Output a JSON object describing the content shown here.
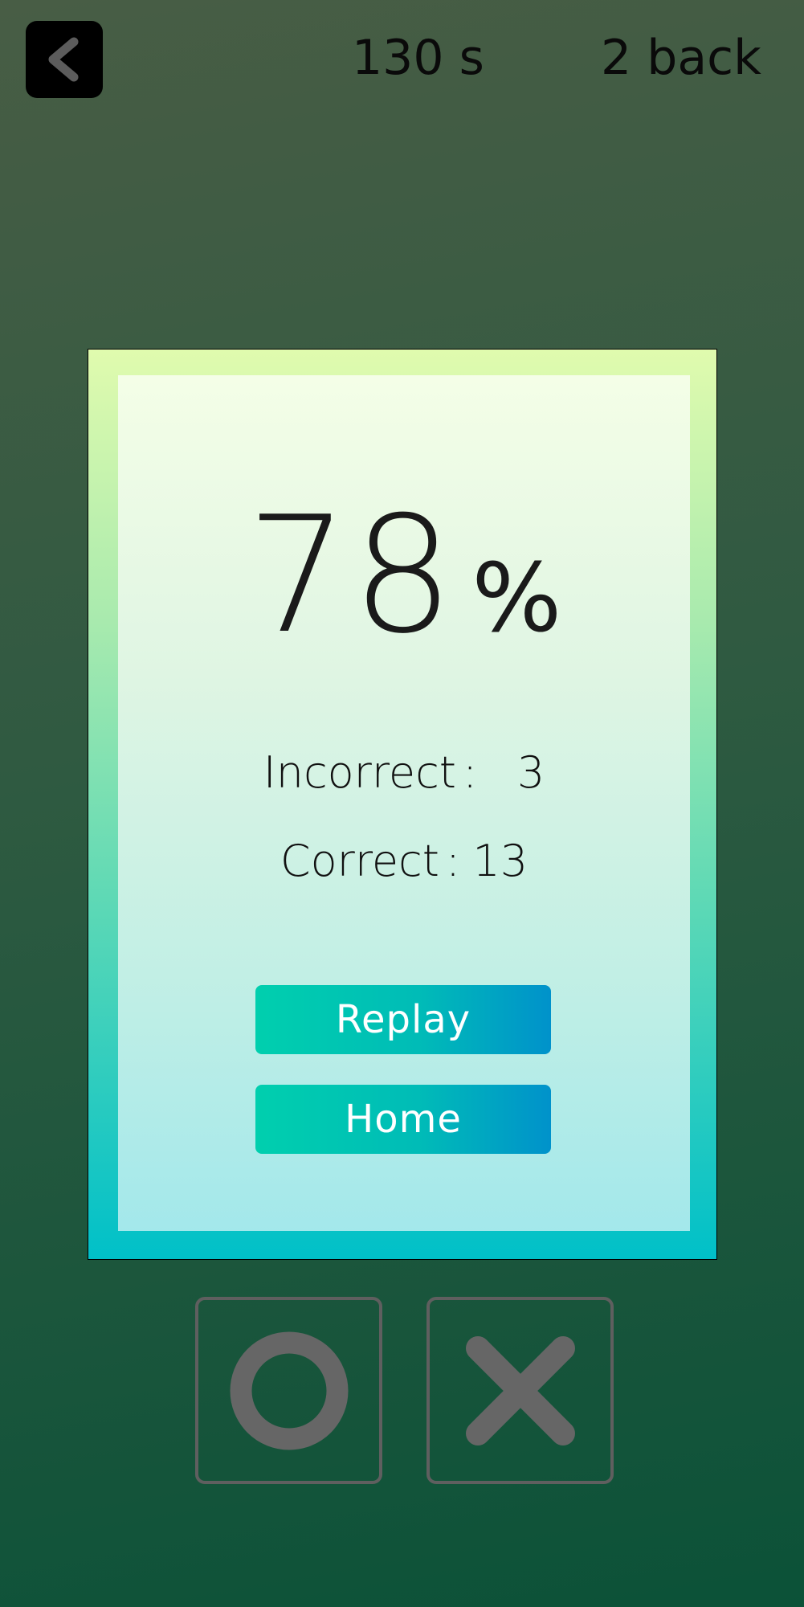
{
  "header": {
    "back_icon": "chevron-left-icon",
    "timer": "130 s",
    "level": "2 back"
  },
  "results": {
    "score_value": "78",
    "score_unit": "%",
    "incorrect_label": "Incorrect",
    "incorrect_value": "3",
    "correct_label": "Correct",
    "correct_value": "13",
    "separator": ":"
  },
  "actions": {
    "replay_label": "Replay",
    "home_label": "Home"
  },
  "answer_buttons": {
    "match_icon": "circle-icon",
    "no_match_icon": "cross-icon"
  },
  "colors": {
    "background_top": "#485d45",
    "background_bottom": "#0b5238",
    "button_start": "#00cfae",
    "button_end": "#0092cb",
    "disabled_icon": "#666666"
  }
}
